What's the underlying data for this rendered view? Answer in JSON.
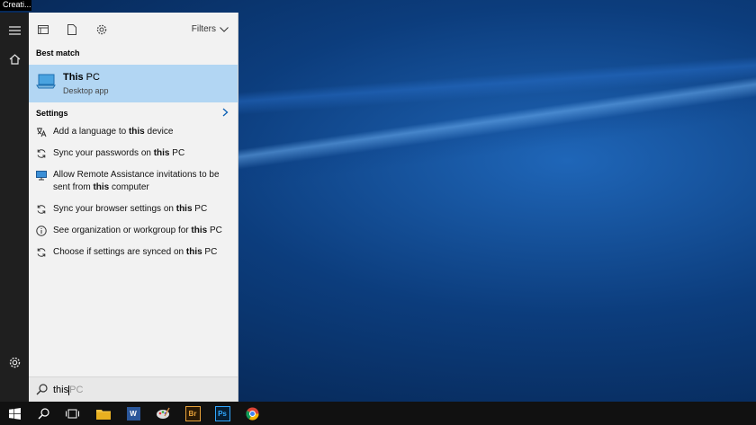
{
  "window": {
    "title_fragment": "Creati..."
  },
  "panel": {
    "filters_label": "Filters",
    "best_match_label": "Best match",
    "best_match": {
      "title_bold": "This",
      "title_rest": " PC",
      "subtitle": "Desktop app"
    },
    "settings_label": "Settings",
    "settings_items": [
      {
        "pre": "Add a language to ",
        "bold": "this",
        "post": " device",
        "icon": "globe-icon"
      },
      {
        "pre": "Sync your passwords on ",
        "bold": "this",
        "post": " PC",
        "icon": "sync-icon"
      },
      {
        "pre": "Allow Remote Assistance invitations to be sent from ",
        "bold": "this",
        "post": " computer",
        "icon": "monitor-icon"
      },
      {
        "pre": "Sync your browser settings on ",
        "bold": "this",
        "post": " PC",
        "icon": "sync-icon"
      },
      {
        "pre": "See organization or workgroup for ",
        "bold": "this",
        "post": " PC",
        "icon": "info-icon"
      },
      {
        "pre": "Choose if settings are synced on ",
        "bold": "this",
        "post": " PC",
        "icon": "sync-icon"
      }
    ]
  },
  "search": {
    "typed": "this",
    "suggestion": "PC"
  },
  "taskbar": {
    "apps": [
      {
        "name": "word",
        "label": "W"
      },
      {
        "name": "bridge",
        "label": "Br"
      },
      {
        "name": "photoshop",
        "label": "Ps"
      }
    ]
  },
  "colors": {
    "accent": "#b2d6f3",
    "panel": "#f2f2f2",
    "taskbar": "#111111"
  }
}
